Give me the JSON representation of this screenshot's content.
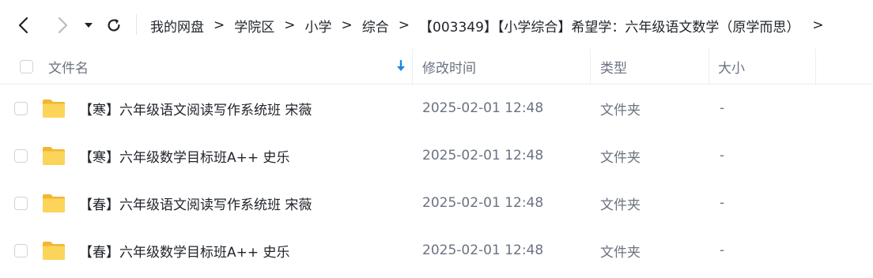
{
  "toolbar": {
    "back_icon": "chevron-left-icon",
    "forward_icon": "chevron-right-icon",
    "history_icon": "caret-down-icon",
    "refresh_icon": "refresh-icon"
  },
  "breadcrumb": {
    "items": [
      "我的网盘",
      "学院区",
      "小学",
      "综合",
      "【003349】【小学综合】希望学：六年级语文数学（原学而思）"
    ],
    "separator": ">",
    "more": ">"
  },
  "table": {
    "headers": {
      "name": "文件名",
      "modified": "修改时间",
      "type": "类型",
      "size": "大小"
    },
    "sort_icon": "arrow-down-icon",
    "rows": [
      {
        "name": "【寒】六年级语文阅读写作系统班  宋薇",
        "modified": "2025-02-01 12:48",
        "type": "文件夹",
        "size": "-"
      },
      {
        "name": "【寒】六年级数学目标班A++  史乐",
        "modified": "2025-02-01 12:48",
        "type": "文件夹",
        "size": "-"
      },
      {
        "name": "【春】六年级语文阅读写作系统班  宋薇",
        "modified": "2025-02-01 12:48",
        "type": "文件夹",
        "size": "-"
      },
      {
        "name": "【春】六年级数学目标班A++  史乐",
        "modified": "2025-02-01 12:48",
        "type": "文件夹",
        "size": "-"
      }
    ]
  },
  "colors": {
    "accent": "#1e88e5",
    "folder": "#f7c948",
    "divider": "#eceef1",
    "muted_text": "#6b7280"
  }
}
